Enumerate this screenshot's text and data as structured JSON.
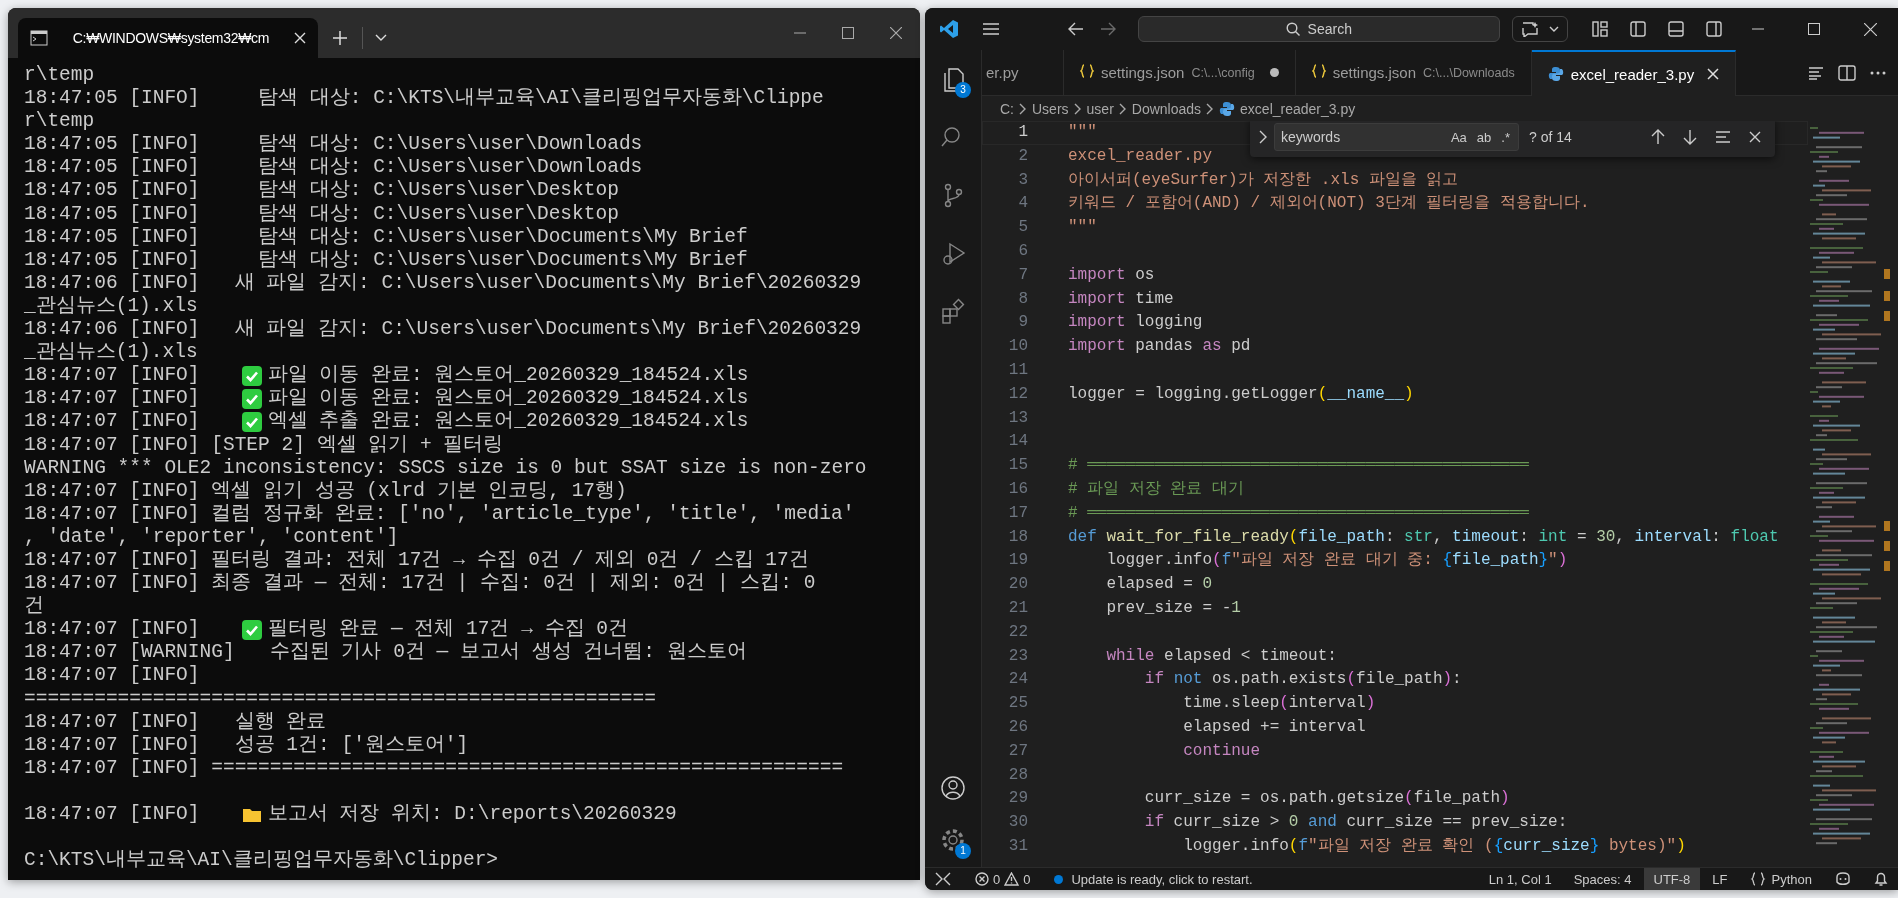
{
  "terminal": {
    "tab_title": "C:₩WINDOWS₩system32₩cm",
    "lines": [
      {
        "kind": "text",
        "text": "r\\temp"
      },
      {
        "kind": "text",
        "text": "18:47:05 [INFO]     탐색 대상: C:\\KTS\\내부교육\\AI\\클리핑업무자동화\\Clippe"
      },
      {
        "kind": "text",
        "text": "r\\temp"
      },
      {
        "kind": "text",
        "text": "18:47:05 [INFO]     탐색 대상: C:\\Users\\user\\Downloads"
      },
      {
        "kind": "text",
        "text": "18:47:05 [INFO]     탐색 대상: C:\\Users\\user\\Downloads"
      },
      {
        "kind": "text",
        "text": "18:47:05 [INFO]     탐색 대상: C:\\Users\\user\\Desktop"
      },
      {
        "kind": "text",
        "text": "18:47:05 [INFO]     탐색 대상: C:\\Users\\user\\Desktop"
      },
      {
        "kind": "text",
        "text": "18:47:05 [INFO]     탐색 대상: C:\\Users\\user\\Documents\\My Brief"
      },
      {
        "kind": "text",
        "text": "18:47:05 [INFO]     탐색 대상: C:\\Users\\user\\Documents\\My Brief"
      },
      {
        "kind": "text",
        "text": "18:47:06 [INFO]   새 파일 감지: C:\\Users\\user\\Documents\\My Brief\\20260329"
      },
      {
        "kind": "text",
        "text": "_관심뉴스(1).xls"
      },
      {
        "kind": "text",
        "text": "18:47:06 [INFO]   새 파일 감지: C:\\Users\\user\\Documents\\My Brief\\20260329"
      },
      {
        "kind": "text",
        "text": "_관심뉴스(1).xls"
      },
      {
        "kind": "check",
        "prefix": "18:47:07 [INFO]",
        "text": "파일 이동 완료: 원스토어_20260329_184524.xls"
      },
      {
        "kind": "check",
        "prefix": "18:47:07 [INFO]",
        "text": "파일 이동 완료: 원스토어_20260329_184524.xls"
      },
      {
        "kind": "check",
        "prefix": "18:47:07 [INFO]",
        "text": "엑셀 추출 완료: 원스토어_20260329_184524.xls"
      },
      {
        "kind": "text",
        "text": "18:47:07 [INFO] [STEP 2] 엑셀 읽기 + 필터링"
      },
      {
        "kind": "text",
        "text": "WARNING *** OLE2 inconsistency: SSCS size is 0 but SSAT size is non-zero"
      },
      {
        "kind": "text",
        "text": "18:47:07 [INFO] 엑셀 읽기 성공 (xlrd 기본 인코딩, 17행)"
      },
      {
        "kind": "text",
        "text": "18:47:07 [INFO] 컬럼 정규화 완료: ['no', 'article_type', 'title', 'media'"
      },
      {
        "kind": "text",
        "text": ", 'date', 'reporter', 'content']"
      },
      {
        "kind": "text",
        "text": "18:47:07 [INFO] 필터링 결과: 전체 17건 → 수집 0건 / 제외 0건 / 스킵 17건"
      },
      {
        "kind": "text",
        "text": "18:47:07 [INFO] 최종 결과 — 전체: 17건 | 수집: 0건 | 제외: 0건 | 스킵: 0"
      },
      {
        "kind": "text",
        "text": "건"
      },
      {
        "kind": "check",
        "prefix": "18:47:07 [INFO]",
        "text": "필터링 완료 — 전체 17건 → 수집 0건"
      },
      {
        "kind": "text",
        "text": "18:47:07 [WARNING]   수집된 기사 0건 — 보고서 생성 건너뜀: 원스토어"
      },
      {
        "kind": "text",
        "text": "18:47:07 [INFO]"
      },
      {
        "kind": "text",
        "text": "======================================================"
      },
      {
        "kind": "text",
        "text": "18:47:07 [INFO]   실행 완료"
      },
      {
        "kind": "text",
        "text": "18:47:07 [INFO]   성공 1건: ['원스토어']"
      },
      {
        "kind": "text",
        "text": "18:47:07 [INFO] ======================================================"
      },
      {
        "kind": "blank"
      },
      {
        "kind": "folder",
        "prefix": "18:47:07 [INFO]",
        "text": "보고서 저장 위치: D:\\reports\\20260329"
      },
      {
        "kind": "blank"
      },
      {
        "kind": "prompt",
        "text": "C:\\KTS\\내부교육\\AI\\클리핑업무자동화\\Clipper>"
      }
    ]
  },
  "editor": {
    "search_placeholder": "Search",
    "tabs": [
      {
        "label": "er.py",
        "selected": false,
        "modified": false
      },
      {
        "kind": "json",
        "label": "settings.json",
        "path": "C:\\...\\config",
        "selected": false,
        "modified": true
      },
      {
        "kind": "json",
        "label": "settings.json",
        "path": "C:\\...\\Downloads",
        "selected": false,
        "modified": false
      },
      {
        "kind": "python",
        "label": "excel_reader_3.py",
        "selected": true,
        "modified": false
      }
    ],
    "breadcrumbs": [
      "C:",
      "Users",
      "user",
      "Downloads",
      "excel_reader_3.py"
    ],
    "activity": [
      {
        "kind": "explorer",
        "badge": "3"
      },
      {
        "kind": "search"
      },
      {
        "kind": "source-control"
      },
      {
        "kind": "run"
      },
      {
        "kind": "extensions"
      }
    ],
    "activity_bottom": [
      {
        "kind": "account"
      },
      {
        "kind": "settings",
        "badge": "1"
      }
    ],
    "find": {
      "value": "keywords",
      "options": [
        {
          "label": "Aa",
          "selected": false
        },
        {
          "label": "ab",
          "selected": false
        },
        {
          "label": ".*",
          "selected": false
        }
      ],
      "count": "? of 14"
    },
    "code": [
      {
        "number": "1",
        "current": true,
        "tokens": [
          {
            "text": "\"\"\"",
            "kind": "string"
          }
        ]
      },
      {
        "number": "2",
        "current": false,
        "tokens": [
          {
            "text": "excel_reader.py",
            "kind": "string"
          }
        ]
      },
      {
        "number": "3",
        "current": false,
        "tokens": [
          {
            "text": "아이서퍼(eyeSurfer)가 저장한 .xls 파일을 읽고",
            "kind": "string"
          }
        ]
      },
      {
        "number": "4",
        "current": false,
        "tokens": [
          {
            "text": "키워드 / 포함어(AND) / 제외어(NOT) 3단계 필터링을 적용합니다.",
            "kind": "string"
          }
        ]
      },
      {
        "number": "5",
        "current": false,
        "tokens": [
          {
            "text": "\"\"\"",
            "kind": "string"
          }
        ]
      },
      {
        "number": "6",
        "current": false
      },
      {
        "number": "7",
        "current": false,
        "tokens": [
          {
            "text": "import",
            "kind": "keyword"
          },
          {
            "text": " os",
            "kind": "plain"
          }
        ]
      },
      {
        "number": "8",
        "current": false,
        "tokens": [
          {
            "text": "import",
            "kind": "keyword"
          },
          {
            "text": " time",
            "kind": "plain"
          }
        ]
      },
      {
        "number": "9",
        "current": false,
        "tokens": [
          {
            "text": "import",
            "kind": "keyword"
          },
          {
            "text": " logging",
            "kind": "plain"
          }
        ]
      },
      {
        "number": "10",
        "current": false,
        "tokens": [
          {
            "text": "import",
            "kind": "keyword"
          },
          {
            "text": " pandas ",
            "kind": "plain"
          },
          {
            "text": "as",
            "kind": "keyword"
          },
          {
            "text": " pd",
            "kind": "plain"
          }
        ]
      },
      {
        "number": "11",
        "current": false
      },
      {
        "number": "12",
        "current": false,
        "tokens": [
          {
            "text": "logger = logging.getLogger",
            "kind": "plain"
          },
          {
            "text": "(",
            "kind": "bracket1"
          },
          {
            "text": "__name__",
            "kind": "variable"
          },
          {
            "text": ")",
            "kind": "bracket1"
          }
        ]
      },
      {
        "number": "13",
        "current": false
      },
      {
        "number": "14",
        "current": false
      },
      {
        "number": "15",
        "current": false,
        "tokens": [
          {
            "text": "# ══════════════════════════════════════════════",
            "kind": "comment"
          }
        ]
      },
      {
        "number": "16",
        "current": false,
        "tokens": [
          {
            "text": "# 파일 저장 완료 대기",
            "kind": "comment"
          }
        ]
      },
      {
        "number": "17",
        "current": false,
        "tokens": [
          {
            "text": "# ══════════════════════════════════════════════",
            "kind": "comment"
          }
        ]
      },
      {
        "number": "18",
        "current": false,
        "tokens": [
          {
            "text": "def ",
            "kind": "storage"
          },
          {
            "text": "wait_for_file_ready",
            "kind": "function"
          },
          {
            "text": "(",
            "kind": "bracket1"
          },
          {
            "text": "file_path",
            "kind": "variable"
          },
          {
            "text": ": ",
            "kind": "plain"
          },
          {
            "text": "str",
            "kind": "type"
          },
          {
            "text": ", ",
            "kind": "plain"
          },
          {
            "text": "timeout",
            "kind": "variable"
          },
          {
            "text": ": ",
            "kind": "plain"
          },
          {
            "text": "int",
            "kind": "type"
          },
          {
            "text": " = ",
            "kind": "plain"
          },
          {
            "text": "30",
            "kind": "number"
          },
          {
            "text": ", ",
            "kind": "plain"
          },
          {
            "text": "interval",
            "kind": "variable"
          },
          {
            "text": ": ",
            "kind": "plain"
          },
          {
            "text": "float",
            "kind": "type"
          }
        ]
      },
      {
        "number": "19",
        "current": false,
        "tokens": [
          {
            "text": "    logger.info",
            "kind": "plain"
          },
          {
            "text": "(",
            "kind": "bracket2"
          },
          {
            "text": "f",
            "kind": "storage"
          },
          {
            "text": "\"파일 저장 완료 대기 중: ",
            "kind": "string"
          },
          {
            "text": "{",
            "kind": "bracket3"
          },
          {
            "text": "file_path",
            "kind": "variable"
          },
          {
            "text": "}",
            "kind": "bracket3"
          },
          {
            "text": "\"",
            "kind": "string"
          },
          {
            "text": ")",
            "kind": "bracket2"
          }
        ]
      },
      {
        "number": "20",
        "current": false,
        "tokens": [
          {
            "text": "    elapsed = ",
            "kind": "plain"
          },
          {
            "text": "0",
            "kind": "number"
          }
        ]
      },
      {
        "number": "21",
        "current": false,
        "tokens": [
          {
            "text": "    prev_size = -",
            "kind": "plain"
          },
          {
            "text": "1",
            "kind": "number"
          }
        ]
      },
      {
        "number": "22",
        "current": false
      },
      {
        "number": "23",
        "current": false,
        "tokens": [
          {
            "text": "    while",
            "kind": "keyword"
          },
          {
            "text": " elapsed < timeout:",
            "kind": "plain"
          }
        ]
      },
      {
        "number": "24",
        "current": false,
        "tokens": [
          {
            "text": "        if ",
            "kind": "keyword"
          },
          {
            "text": "not",
            "kind": "storage"
          },
          {
            "text": " os.path.exists",
            "kind": "plain"
          },
          {
            "text": "(",
            "kind": "bracket2"
          },
          {
            "text": "file_path",
            "kind": "plain"
          },
          {
            "text": ")",
            "kind": "bracket2"
          },
          {
            "text": ":",
            "kind": "plain"
          }
        ]
      },
      {
        "number": "25",
        "current": false,
        "tokens": [
          {
            "text": "            time.sleep",
            "kind": "plain"
          },
          {
            "text": "(",
            "kind": "bracket2"
          },
          {
            "text": "interval",
            "kind": "plain"
          },
          {
            "text": ")",
            "kind": "bracket2"
          }
        ]
      },
      {
        "number": "26",
        "current": false,
        "tokens": [
          {
            "text": "            elapsed += interval",
            "kind": "plain"
          }
        ]
      },
      {
        "number": "27",
        "current": false,
        "tokens": [
          {
            "text": "            continue",
            "kind": "keyword"
          }
        ]
      },
      {
        "number": "28",
        "current": false
      },
      {
        "number": "29",
        "current": false,
        "tokens": [
          {
            "text": "        curr_size = os.path.getsize",
            "kind": "plain"
          },
          {
            "text": "(",
            "kind": "bracket2"
          },
          {
            "text": "file_path",
            "kind": "plain"
          },
          {
            "text": ")",
            "kind": "bracket2"
          }
        ]
      },
      {
        "number": "30",
        "current": false,
        "tokens": [
          {
            "text": "        if",
            "kind": "keyword"
          },
          {
            "text": " curr_size > ",
            "kind": "plain"
          },
          {
            "text": "0 ",
            "kind": "number"
          },
          {
            "text": "and",
            "kind": "storage"
          },
          {
            "text": " curr_size == prev_size:",
            "kind": "plain"
          }
        ]
      },
      {
        "number": "31",
        "current": false,
        "tokens": [
          {
            "text": "            logger.info",
            "kind": "plain"
          },
          {
            "text": "(",
            "kind": "bracket1"
          },
          {
            "text": "f",
            "kind": "storage"
          },
          {
            "text": "\"파일 저장 완료 확인 (",
            "kind": "string"
          },
          {
            "text": "{",
            "kind": "bracket3"
          },
          {
            "text": "curr_size",
            "kind": "variable"
          },
          {
            "text": "}",
            "kind": "bracket3"
          },
          {
            "text": " bytes)\"",
            "kind": "string"
          },
          {
            "text": ")",
            "kind": "bracket1"
          }
        ]
      }
    ],
    "status": {
      "errors": "0",
      "warnings": "0",
      "message": "Update is ready, click to restart.",
      "items": [
        {
          "text": "Ln 1, Col 1",
          "highlighted": false
        },
        {
          "text": "Spaces: 4",
          "highlighted": false
        },
        {
          "text": "UTF-8",
          "highlighted": true
        },
        {
          "text": "LF",
          "highlighted": false
        },
        {
          "kind": "language",
          "text": "Python",
          "highlighted": false
        }
      ]
    }
  }
}
